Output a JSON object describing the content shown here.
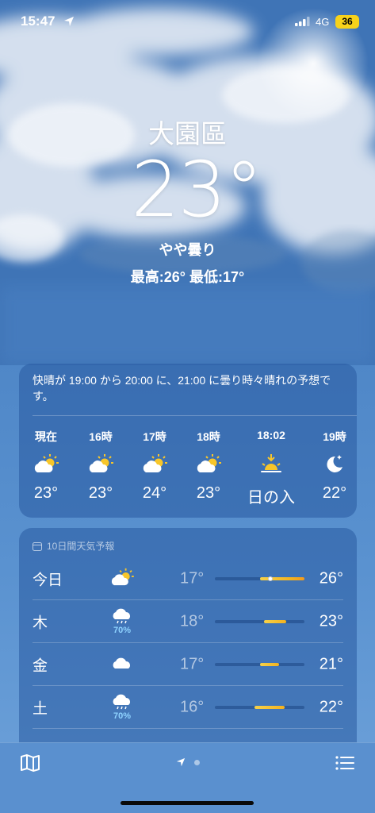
{
  "status": {
    "time": "15:47",
    "network": "4G",
    "battery": "36"
  },
  "weather": {
    "city": "大園區",
    "temperature": "23°",
    "condition": "やや曇り",
    "high_low": "最高:26°  最低:17°"
  },
  "hourly": {
    "summary": "快晴が 19:00 から 20:00 に、21:00 に曇り時々晴れの予想です。",
    "items": [
      {
        "label": "現在",
        "icon": "partly-cloudy-day-icon",
        "value": "23°"
      },
      {
        "label": "16時",
        "icon": "partly-cloudy-day-icon",
        "value": "23°"
      },
      {
        "label": "17時",
        "icon": "partly-cloudy-day-icon",
        "value": "24°"
      },
      {
        "label": "18時",
        "icon": "partly-cloudy-day-icon",
        "value": "23°"
      },
      {
        "label": "18:02",
        "icon": "sunset-icon",
        "value": "日の入"
      },
      {
        "label": "19時",
        "icon": "moon-stars-icon",
        "value": "22°"
      }
    ]
  },
  "daily": {
    "header": "10日間天気予報",
    "items": [
      {
        "day": "今日",
        "icon": "partly-cloudy-day-icon",
        "precip": "",
        "low": "17°",
        "high": "26°",
        "range_start": 0.5,
        "range_end": 1.0,
        "current": 0.62
      },
      {
        "day": "木",
        "icon": "rain-cloud-icon",
        "precip": "70%",
        "low": "18°",
        "high": "23°",
        "range_start": 0.55,
        "range_end": 0.8,
        "current": null
      },
      {
        "day": "金",
        "icon": "cloud-icon",
        "precip": "",
        "low": "17°",
        "high": "21°",
        "range_start": 0.5,
        "range_end": 0.72,
        "current": null
      },
      {
        "day": "土",
        "icon": "rain-cloud-icon",
        "precip": "70%",
        "low": "16°",
        "high": "22°",
        "range_start": 0.44,
        "range_end": 0.78,
        "current": null
      }
    ]
  },
  "colors": {
    "bar_fill": "#f3c22b",
    "precip_text": "#8fd3ff",
    "battery": "#f7d21b"
  }
}
